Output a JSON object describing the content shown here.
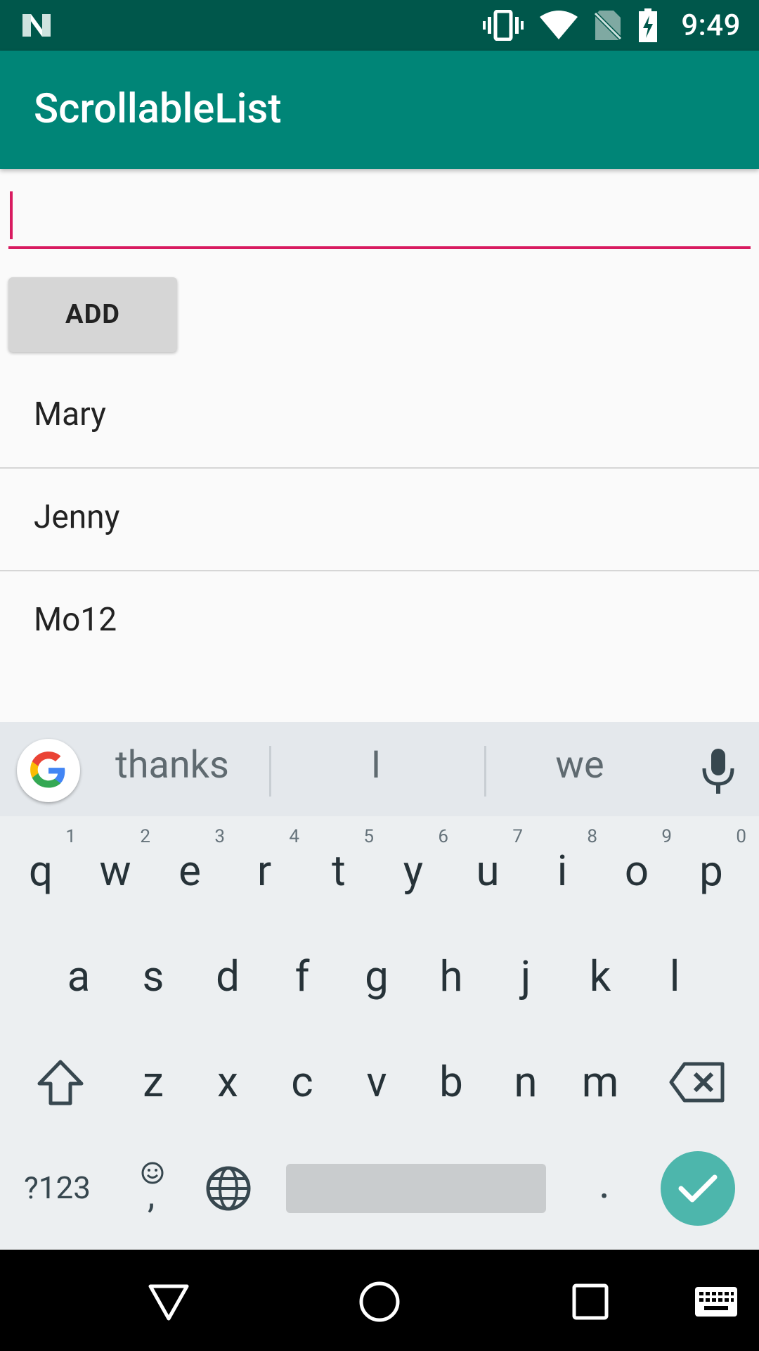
{
  "status_bar": {
    "time": "9:49",
    "icons": [
      "n-logo-icon",
      "vibrate-icon",
      "wifi-icon",
      "no-sim-icon",
      "battery-charging-icon"
    ]
  },
  "app_bar": {
    "title": "ScrollableList"
  },
  "input": {
    "value": "",
    "placeholder": ""
  },
  "add_button": {
    "label": "ADD"
  },
  "list": {
    "items": [
      "Mary",
      "Jenny",
      "Mo12"
    ]
  },
  "keyboard": {
    "suggestions": [
      "thanks",
      "I",
      "we"
    ],
    "row1": [
      "q",
      "w",
      "e",
      "r",
      "t",
      "y",
      "u",
      "i",
      "o",
      "p"
    ],
    "row1_hints": [
      "1",
      "2",
      "3",
      "4",
      "5",
      "6",
      "7",
      "8",
      "9",
      "0"
    ],
    "row2": [
      "a",
      "s",
      "d",
      "f",
      "g",
      "h",
      "j",
      "k",
      "l"
    ],
    "row3": [
      "z",
      "x",
      "c",
      "v",
      "b",
      "n",
      "m"
    ],
    "symbols_label": "?123",
    "comma_label": ",",
    "period_label": "."
  },
  "colors": {
    "status_bar": "#00574b",
    "app_bar": "#008577",
    "accent": "#d81b60",
    "enter_key": "#4db6ac"
  }
}
